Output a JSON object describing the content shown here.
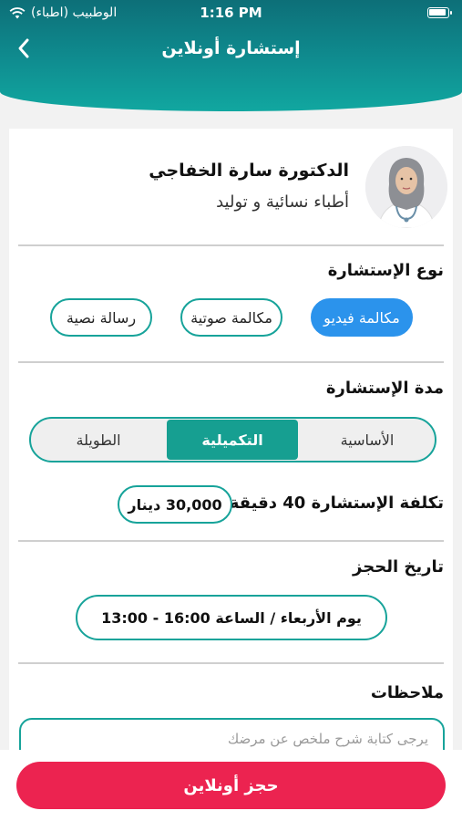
{
  "status_bar": {
    "carrier": "الوطبيب (اطباء)",
    "time": "1:16 PM"
  },
  "nav": {
    "title": "إستشارة أونلاين",
    "back_icon": "chevron-left-icon"
  },
  "doctor": {
    "name": "الدكتورة سارة الخفاجي",
    "specialty": "أطباء نسائية و توليد"
  },
  "consultation_type": {
    "title": "نوع الإستشارة",
    "options": [
      "مكالمة فيديو",
      "مكالمة صوتية",
      "رسالة نصية"
    ],
    "selected": "مكالمة فيديو"
  },
  "consultation_duration": {
    "title": "مدة الإستشارة",
    "options": [
      "الأساسية",
      "التكميلية",
      "الطويلة"
    ],
    "selected": "التكميلية"
  },
  "cost": {
    "label": "تكلفة الإستشارة 40 دقيقة",
    "price": "30,000 دينار"
  },
  "booking_date": {
    "title": "تاريخ الحجز",
    "value": "يوم الأربعاء / الساعة 16:00 - 13:00"
  },
  "notes": {
    "title": "ملاحظات",
    "placeholder": "يرجى كتابة شرح ملخص عن مرضك"
  },
  "book_button": {
    "label": "حجز أونلاين"
  },
  "colors": {
    "teal": "#17a39a",
    "blue_active": "#2b93ec",
    "segment_active": "#169f91",
    "book_button": "#ec2350"
  }
}
